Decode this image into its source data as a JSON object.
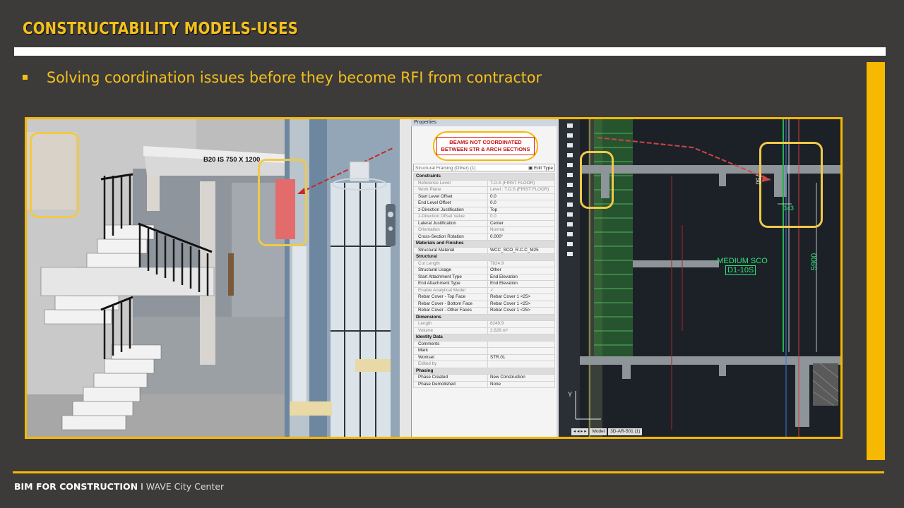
{
  "slide": {
    "title": "CONSTRUCTABILITY MODELS-USES",
    "bullet": "Solving coordination issues before they become RFI from contractor"
  },
  "model_view": {
    "beam_label": "B20 IS 750 X 1200"
  },
  "properties": {
    "title": "Properties",
    "callout_line1": "BEAMS NOT COORDINATED",
    "callout_line2": "BETWEEN STR & ARCH SECTIONS",
    "type_selector": "Structural Framing (Other) (1)",
    "edit_type": "Edit Type",
    "rows": [
      {
        "group": "Constraints"
      },
      {
        "k": "Reference Level",
        "v": "T.O.S (FIRST FLOOR)",
        "ro": true
      },
      {
        "k": "Work Plane",
        "v": "Level : T.O.S (FIRST FLOOR)",
        "ro": true
      },
      {
        "k": "Start Level Offset",
        "v": "0.0"
      },
      {
        "k": "End Level Offset",
        "v": "0.0"
      },
      {
        "k": "z-Direction Justification",
        "v": "Top"
      },
      {
        "k": "z-Direction Offset Value",
        "v": "0.0",
        "ro": true
      },
      {
        "k": "Lateral Justification",
        "v": "Center"
      },
      {
        "k": "Orientation",
        "v": "Normal",
        "ro": true
      },
      {
        "k": "Cross-Section Rotation",
        "v": "0.000°"
      },
      {
        "group": "Materials and Finishes"
      },
      {
        "k": "Structural Material",
        "v": "WCC_SCO_R.C.C_M25"
      },
      {
        "group": "Structural"
      },
      {
        "k": "Cut Length",
        "v": "7824.9",
        "ro": true
      },
      {
        "k": "Structural Usage",
        "v": "Other"
      },
      {
        "k": "Start Attachment Type",
        "v": "End Elevation"
      },
      {
        "k": "End Attachment Type",
        "v": "End Elevation"
      },
      {
        "k": "Enable Analytical Model",
        "v": "✓",
        "ro": true
      },
      {
        "k": "Rebar Cover - Top Face",
        "v": "Rebar Cover 1 <25>"
      },
      {
        "k": "Rebar Cover - Bottom Face",
        "v": "Rebar Cover 1 <25>"
      },
      {
        "k": "Rebar Cover - Other Faces",
        "v": "Rebar Cover 1 <25>"
      },
      {
        "group": "Dimensions"
      },
      {
        "k": "Length",
        "v": "6249.9",
        "ro": true
      },
      {
        "k": "Volume",
        "v": "2.626 m³",
        "ro": true
      },
      {
        "group": "Identity Data"
      },
      {
        "k": "Comments",
        "v": ""
      },
      {
        "k": "Mark",
        "v": ""
      },
      {
        "k": "Workset",
        "v": "STR.01"
      },
      {
        "k": "Edited by",
        "v": "",
        "ro": true
      },
      {
        "group": "Phasing"
      },
      {
        "k": "Phase Created",
        "v": "New Construction"
      },
      {
        "k": "Phase Demolished",
        "v": "None"
      }
    ]
  },
  "cad": {
    "dim_750": "750",
    "dim_343": "343",
    "dim_5900": "5900",
    "room_name": "MEDIUM SCO",
    "room_number": "D1-10S",
    "axis_y": "Y",
    "tab_model": "Model",
    "tab_layout": "3D-AR-501 (1)"
  },
  "footer": {
    "bold": "BIM FOR CONSTRUCTION",
    "sep": "I",
    "sub": "WAVE City Center"
  },
  "colors": {
    "accent": "#f6b800",
    "background": "#3c3b39",
    "callout_red": "#c61111",
    "cad_green": "#33e27a"
  }
}
